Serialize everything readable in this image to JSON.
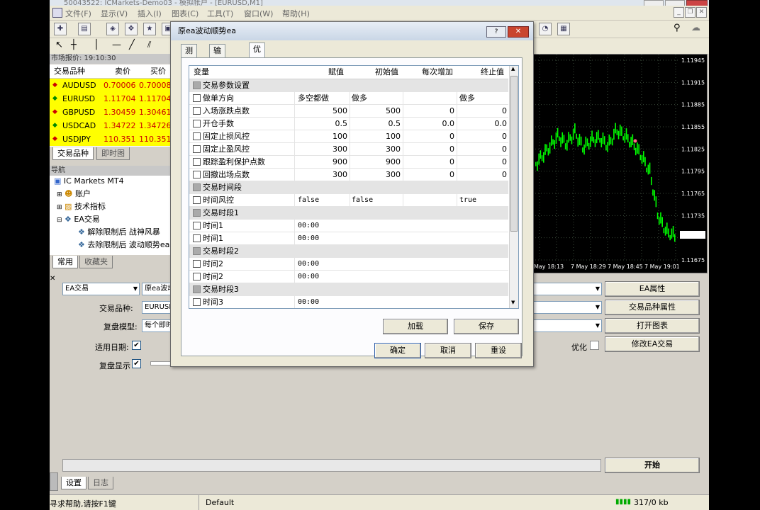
{
  "app": {
    "title_fragment": "50043522: ICMarkets-Demo03 - 模拟帐户 - [EURUSD,M1]",
    "menu": [
      "文件(F)",
      "显示(V)",
      "插入(I)",
      "图表(C)",
      "工具(T)",
      "窗口(W)",
      "帮助(H)"
    ]
  },
  "market_watch": {
    "header": "市场报价: 19:10:30",
    "columns": [
      "交易品种",
      "卖价",
      "买价"
    ],
    "rows": [
      {
        "symbol": "AUDUSD",
        "bid": "0.70006",
        "ask": "0.70008"
      },
      {
        "symbol": "EURUSD",
        "bid": "1.11704",
        "ask": "1.11704"
      },
      {
        "symbol": "GBPUSD",
        "bid": "1.30459",
        "ask": "1.30461"
      },
      {
        "symbol": "USDCAD",
        "bid": "1.34722",
        "ask": "1.34726"
      },
      {
        "symbol": "USDJPY",
        "bid": "110.351",
        "ask": "110.351"
      }
    ],
    "tabs": [
      "交易品种",
      "即时图"
    ]
  },
  "navigator": {
    "header": "导航",
    "root": "IC Markets MT4",
    "items": [
      "账户",
      "技术指标",
      "EA交易",
      "解除限制后 战神风暴",
      "去除限制后 波动顺势ea"
    ],
    "tabs": [
      "常用",
      "收藏夹"
    ]
  },
  "chart": {
    "price_labels": [
      "1.11945",
      "1.11915",
      "1.11885",
      "1.11855",
      "1.11825",
      "1.11795",
      "1.11765",
      "1.11735",
      "1.11704",
      "1.11675"
    ],
    "time_labels": [
      "May 18:13",
      "7 May 18:29",
      "7 May 18:45",
      "7 May 19:01"
    ]
  },
  "tester": {
    "ea_select": "EA交易",
    "ea_name": "原ea波动",
    "symbol_label": "交易品种:",
    "symbol_value": "EURUSD,",
    "model_label": "复盘模型:",
    "model_value": "每个即时",
    "date_label": "适用日期:",
    "visual_label": "复盘显示",
    "optimize_label": "优化",
    "buttons": {
      "ea_props": "EA属性",
      "symbol_props": "交易品种属性",
      "open_chart": "打开图表",
      "modify_ea": "修改EA交易",
      "start": "开始"
    },
    "tabs": [
      "设置",
      "日志"
    ]
  },
  "statusbar": {
    "help": "寻求帮助,请按F1键",
    "profile": "Default",
    "traffic": "317/0 kb"
  },
  "dialog": {
    "title": "原ea波动顺势ea",
    "tabs": [
      "测试",
      "输入参数",
      "优化"
    ],
    "columns": [
      "变量",
      "赋值",
      "初始值",
      "每次增加",
      "终止值"
    ],
    "rows": [
      {
        "name": "交易参数设置",
        "group": true,
        "value": "",
        "start": "",
        "step": "",
        "stop": ""
      },
      {
        "name": "做单方向",
        "group": false,
        "value": "多空都做",
        "start": "做多",
        "step": "",
        "stop": "做多",
        "align": "left"
      },
      {
        "name": "入场涨跌点数",
        "group": false,
        "value": "500",
        "start": "500",
        "step": "0",
        "stop": "0"
      },
      {
        "name": "开仓手数",
        "group": false,
        "value": "0.5",
        "start": "0.5",
        "step": "0.0",
        "stop": "0.0"
      },
      {
        "name": "固定止损风控",
        "group": false,
        "value": "100",
        "start": "100",
        "step": "0",
        "stop": "0"
      },
      {
        "name": "固定止盈风控",
        "group": false,
        "value": "300",
        "start": "300",
        "step": "0",
        "stop": "0"
      },
      {
        "name": "跟踪盈利保护点数",
        "group": false,
        "value": "900",
        "start": "900",
        "step": "0",
        "stop": "0"
      },
      {
        "name": "回撤出场点数",
        "group": false,
        "value": "300",
        "start": "300",
        "step": "0",
        "stop": "0"
      },
      {
        "name": "交易时间段",
        "group": true,
        "value": "",
        "start": "",
        "step": "",
        "stop": ""
      },
      {
        "name": "时间风控",
        "group": false,
        "value": "false",
        "start": "false",
        "step": "",
        "stop": "true",
        "align": "left",
        "mono": true
      },
      {
        "name": "交易时段1",
        "group": true,
        "value": "",
        "start": "",
        "step": "",
        "stop": ""
      },
      {
        "name": "时间1",
        "group": false,
        "value": "00:00",
        "start": "",
        "step": "",
        "stop": "",
        "align": "left",
        "mono": true,
        "wide": true
      },
      {
        "name": "时间1",
        "group": false,
        "value": "00:00",
        "start": "",
        "step": "",
        "stop": "",
        "align": "left",
        "mono": true,
        "wide": true
      },
      {
        "name": "交易时段2",
        "group": true,
        "value": "",
        "start": "",
        "step": "",
        "stop": ""
      },
      {
        "name": "时间2",
        "group": false,
        "value": "00:00",
        "start": "",
        "step": "",
        "stop": "",
        "align": "left",
        "mono": true,
        "wide": true
      },
      {
        "name": "时间2",
        "group": false,
        "value": "00:00",
        "start": "",
        "step": "",
        "stop": "",
        "align": "left",
        "mono": true,
        "wide": true
      },
      {
        "name": "交易时段3",
        "group": true,
        "value": "",
        "start": "",
        "step": "",
        "stop": ""
      },
      {
        "name": "时间3",
        "group": false,
        "value": "00:00",
        "start": "",
        "step": "",
        "stop": "",
        "align": "left",
        "mono": true,
        "wide": true
      },
      {
        "name": "时间3",
        "group": false,
        "value": "00:00",
        "start": "",
        "step": "",
        "stop": "",
        "align": "left",
        "mono": true,
        "wide": true
      }
    ],
    "buttons": {
      "load": "加载",
      "save": "保存",
      "ok": "确定",
      "cancel": "取消",
      "reset": "重设",
      "help": "?",
      "close": "✕"
    }
  },
  "colors": {
    "market_row_bg": "#ffff00",
    "price_red": "#cc0000",
    "chart_bg": "#000000",
    "candle_green": "#00ff00",
    "chart_grid": "#3a4a3a"
  }
}
